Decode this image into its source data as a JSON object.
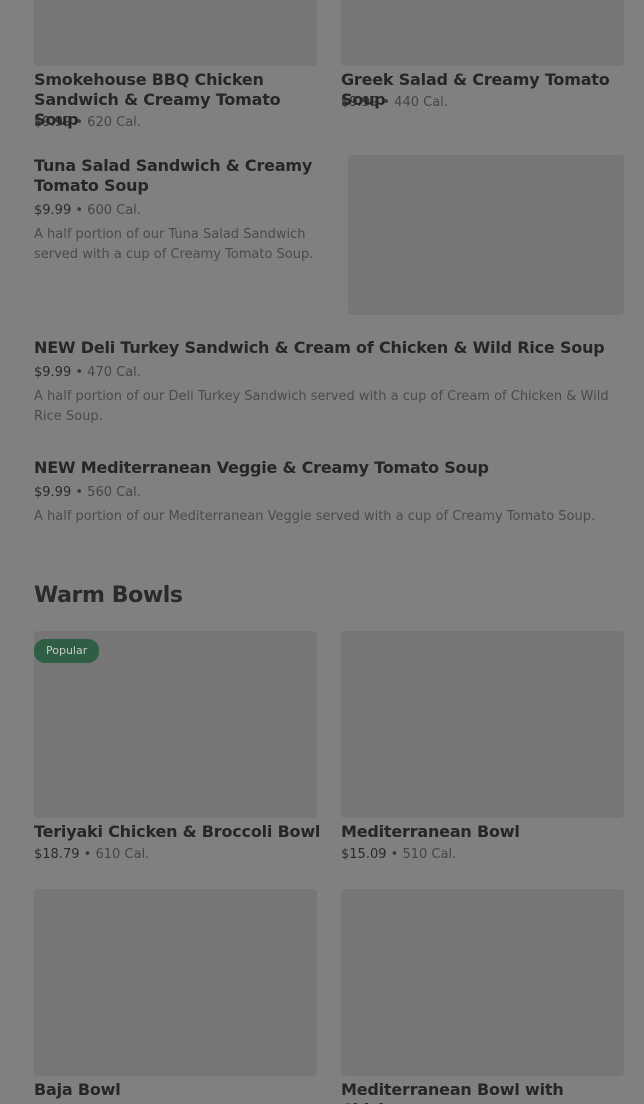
{
  "items": [
    {
      "name": "Smokehouse BBQ Chicken Sandwich & Creamy Tomato Soup",
      "price": "$9.99",
      "sep": "•",
      "cal": "620 Cal."
    },
    {
      "name": "Greek Salad & Creamy Tomato Soup",
      "price": "$9.99",
      "sep": "•",
      "cal": "440 Cal."
    },
    {
      "name": "Tuna Salad Sandwich & Creamy Tomato Soup",
      "price": "$9.99",
      "sep": "•",
      "cal": "600 Cal.",
      "desc": "A half portion of our Tuna Salad Sandwich served with a cup of Creamy Tomato Soup."
    },
    {
      "name": "NEW Deli Turkey Sandwich & Cream of Chicken & Wild Rice Soup",
      "price": "$9.99",
      "sep": "•",
      "cal": "470 Cal.",
      "desc": "A half portion of our Deli Turkey Sandwich served with a cup of Cream of Chicken & Wild Rice Soup."
    },
    {
      "name": "NEW Mediterranean Veggie & Creamy Tomato Soup",
      "price": "$9.99",
      "sep": "•",
      "cal": "560 Cal.",
      "desc": "A half portion of our Mediterranean Veggie served with a cup of Creamy Tomato Soup."
    }
  ],
  "warm_bowls": {
    "heading": "Warm Bowls",
    "badge": "Popular",
    "items": [
      {
        "name": "Teriyaki Chicken & Broccoli Bowl",
        "price": "$18.79",
        "sep": "•",
        "cal": "610 Cal."
      },
      {
        "name": "Mediterranean Bowl",
        "price": "$15.09",
        "sep": "•",
        "cal": "510 Cal."
      },
      {
        "name": "Baja Bowl"
      },
      {
        "name": "Mediterranean Bowl with Chicken"
      }
    ]
  }
}
